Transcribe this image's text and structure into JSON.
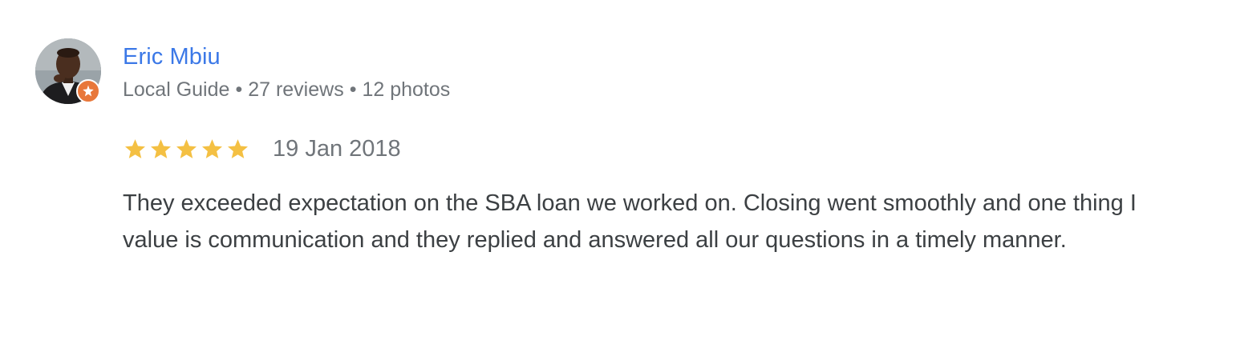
{
  "review": {
    "author_name": "Eric Mbiu",
    "author_meta": {
      "level": "Local Guide",
      "reviews": "27 reviews",
      "photos": "12 photos",
      "separator": "•"
    },
    "rating": 5,
    "rating_max": 5,
    "date": "19 Jan 2018",
    "text": "They exceeded expectation on the SBA loan we worked on. Closing went smoothly and one thing I value is communication and they replied and answered all our questions in a timely manner."
  },
  "icons": {
    "avatar": "profile-photo",
    "badge": "local-guide-badge-icon",
    "star": "star-icon"
  },
  "colors": {
    "name_link": "#3b78e7",
    "meta_text": "#70757a",
    "star_filled": "#f4c043",
    "badge": "#e8773a",
    "body_text": "#3c4043"
  }
}
